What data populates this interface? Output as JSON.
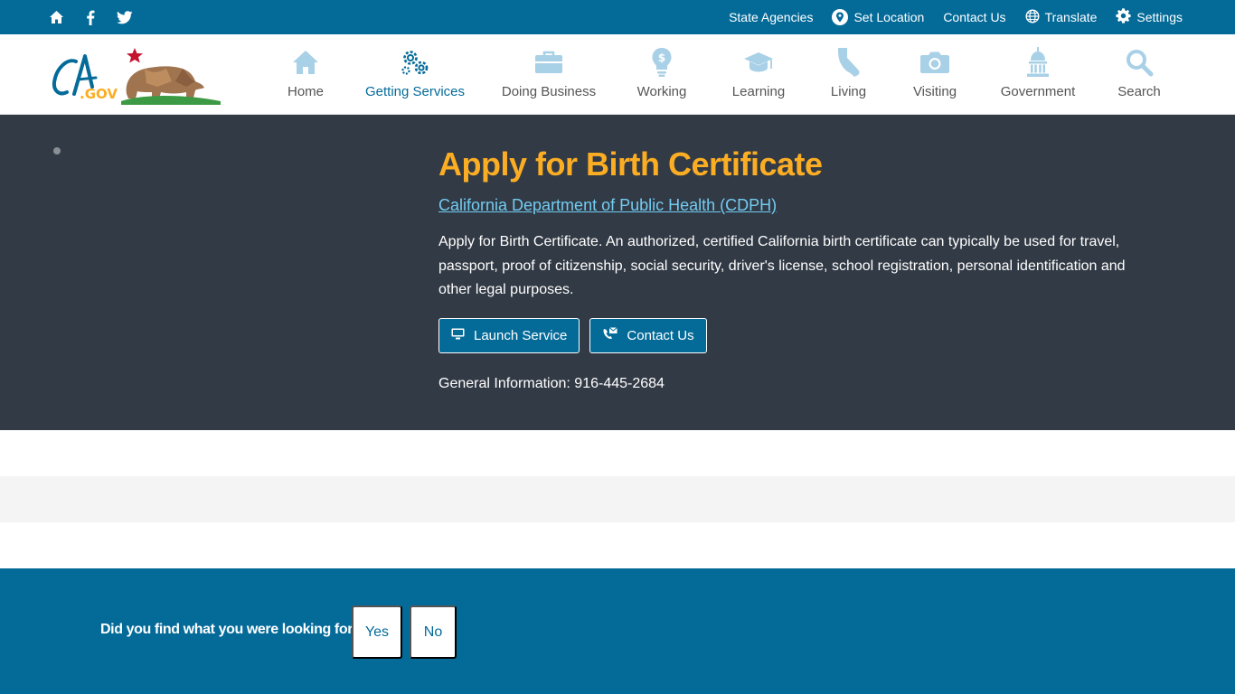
{
  "utility": {
    "social_icons": [
      "home-icon",
      "facebook-icon",
      "twitter-icon"
    ],
    "links": {
      "state_agencies": "State Agencies",
      "set_location": "Set Location",
      "contact_us": "Contact Us",
      "translate": "Translate",
      "settings": "Settings"
    }
  },
  "logo": {
    "text": "CA.GOV"
  },
  "nav": {
    "items": [
      {
        "label": "Home",
        "icon": "house-icon"
      },
      {
        "label": "Getting Services",
        "icon": "gears-icon",
        "active": true
      },
      {
        "label": "Doing Business",
        "icon": "briefcase-icon"
      },
      {
        "label": "Working",
        "icon": "lightbulb-dollar-icon"
      },
      {
        "label": "Learning",
        "icon": "graduation-cap-icon"
      },
      {
        "label": "Living",
        "icon": "california-icon"
      },
      {
        "label": "Visiting",
        "icon": "camera-icon"
      },
      {
        "label": "Government",
        "icon": "capitol-icon"
      },
      {
        "label": "Search",
        "icon": "search-icon"
      }
    ]
  },
  "hero": {
    "title": "Apply for Birth Certificate",
    "department": "California Department of Public Health (CDPH)",
    "description": "Apply for Birth Certificate. An authorized, certified California birth certificate can typically be used for travel, passport, proof of citizenship, social security, driver's license, school registration, personal identification and other legal purposes.",
    "launch_label": "Launch Service",
    "contact_label": "Contact Us",
    "general_info": "General Information: 916-445-2684"
  },
  "feedback": {
    "question": "Did you find what you were looking for?",
    "yes": "Yes",
    "no": "No"
  },
  "colors": {
    "brand_blue": "#046b99",
    "hero_bg": "#323a45",
    "title_gold": "#fbad23",
    "link_blue": "#72ccf2"
  }
}
